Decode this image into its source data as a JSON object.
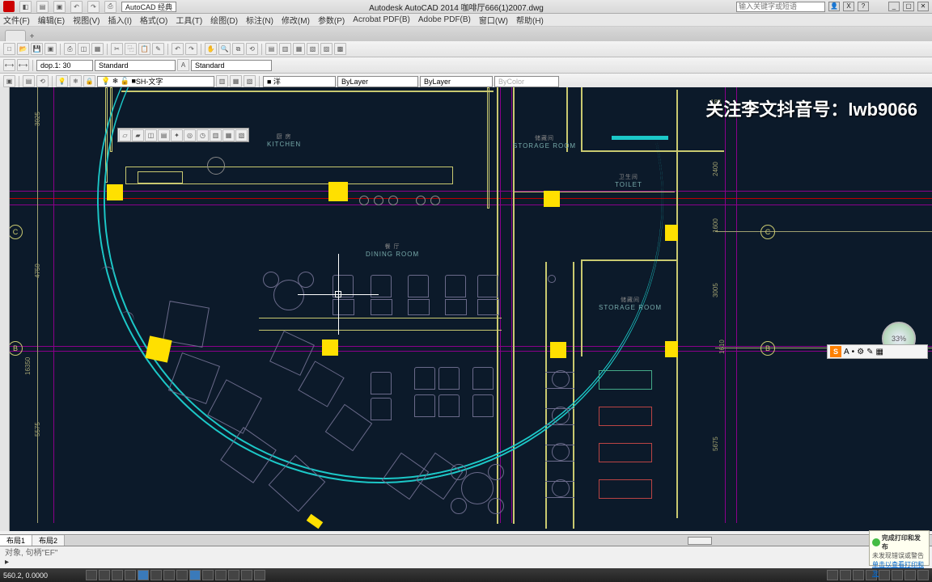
{
  "app": {
    "title": "Autodesk AutoCAD 2014   咖啡厅666(1)2007.dwg",
    "workspace": "AutoCAD 经典",
    "search_placeholder": "输入关键字或短语"
  },
  "menu": [
    "文件(F)",
    "编辑(E)",
    "视图(V)",
    "插入(I)",
    "格式(O)",
    "工具(T)",
    "绘图(D)",
    "标注(N)",
    "修改(M)",
    "参数(P)",
    "Acrobat PDF(B)",
    "Adobe PDF(B)",
    "窗口(W)",
    "帮助(H)"
  ],
  "file_tab": "",
  "toolbar2": {
    "dop_label": "dop.1: 30",
    "text_style": "Standard",
    "dim_style": "Standard"
  },
  "toolbar3": {
    "layer": "SH-文字",
    "color": "■ 洋",
    "ltype": "ByLayer",
    "lweight": "ByLayer",
    "plot": "ByColor"
  },
  "rooms": {
    "kitchen_cn": "厨 房",
    "kitchen_en": "KITCHEN",
    "storage1_cn": "储藏间",
    "storage1_en": "STORAGE ROOM",
    "toilet_cn": "卫生间",
    "toilet_en": "TOILET",
    "dining_cn": "餐 厅",
    "dining_en": "DINING ROOM",
    "storage2_cn": "储藏间",
    "storage2_en": "STORAGE ROOM"
  },
  "dims": {
    "d1": "3025",
    "d2": "4750",
    "d3": "5575",
    "d4": "16350",
    "d5": "2400",
    "d6": "1600",
    "d7": "3005",
    "d8": "1610",
    "d9": "5675",
    "d10": "185"
  },
  "bubbles": {
    "c": "C",
    "b": "B"
  },
  "watermark": "关注李文抖音号：lwb9066",
  "nav_pct": "33%",
  "ime": {
    "s": "S",
    "a": "A"
  },
  "layout_tabs": [
    "布局1",
    "布局2"
  ],
  "cmd_history": "对象,  句柄\"EF\"",
  "status": {
    "coords": "560.2,  0.0000"
  },
  "notif": {
    "title": "完成打印和发布",
    "line1": "未发现错误或警告",
    "link": "单击以查看打印和发"
  }
}
